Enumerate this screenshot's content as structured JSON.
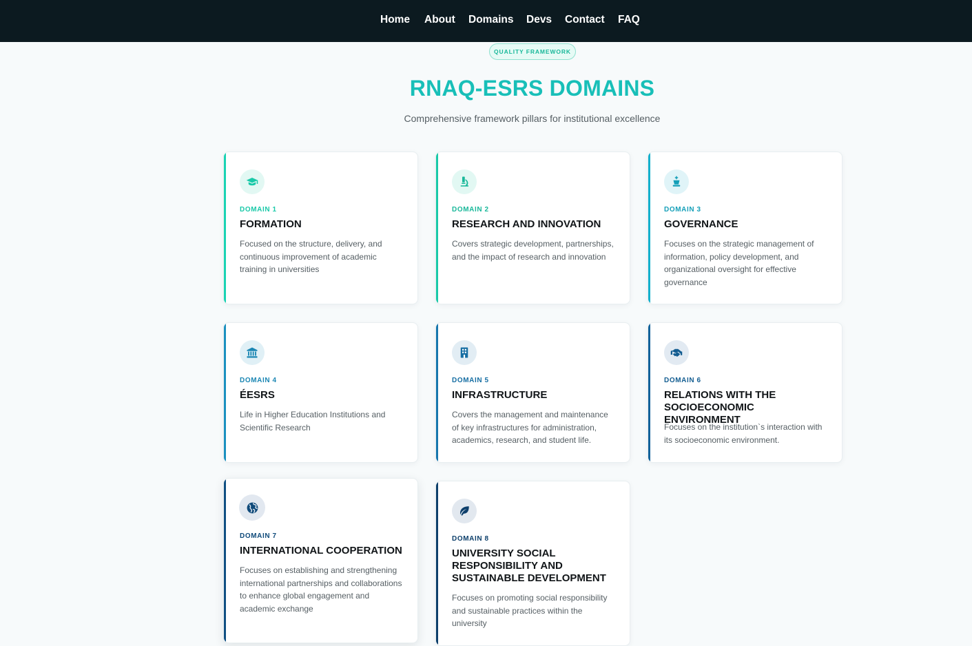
{
  "nav": {
    "items": [
      "Home",
      "About",
      "Domains",
      "Devs",
      "Contact",
      "FAQ"
    ]
  },
  "hero": {
    "badge": "QUALITY FRAMEWORK",
    "title": "RNAQ-ESRS DOMAINS",
    "subtitle": "Comprehensive framework pillars for institutional excellence"
  },
  "domains": [
    {
      "label": "DOMAIN 1",
      "title": "FORMATION",
      "description": "Focused on the structure, delivery, and continuous improvement of academic training in universities",
      "icon": "graduation-cap-icon",
      "accent": "#19d3b3"
    },
    {
      "label": "DOMAIN 2",
      "title": "RESEARCH AND INNOVATION",
      "description": "Covers strategic development, partnerships, and the impact of research and innovation",
      "icon": "microscope-icon",
      "accent": "#19c9a8"
    },
    {
      "label": "DOMAIN 3",
      "title": "GOVERNANCE",
      "description": "Focuses on the strategic management of information, policy development, and organizational oversight for effective governance",
      "icon": "chess-king-icon",
      "accent": "#14b0cc"
    },
    {
      "label": "DOMAIN 4",
      "title": "ÉESRS",
      "description": "Life in Higher Education Institutions and Scientific Research",
      "icon": "landmark-icon",
      "accent": "#1a90bf"
    },
    {
      "label": "DOMAIN 5",
      "title": "INFRASTRUCTURE",
      "description": "Covers the management and maintenance of key infrastructures for administration, academics, research, and student life.",
      "icon": "building-icon",
      "accent": "#1676ad"
    },
    {
      "label": "DOMAIN 6",
      "title": "RELATIONS WITH THE SOCIOECONOMIC ENVIRONMENT",
      "description": "Focuses on the institution`s interaction with its socioeconomic environment.",
      "icon": "handshake-icon",
      "accent": "#12629a"
    },
    {
      "label": "DOMAIN 7",
      "title": "INTERNATIONAL COOPERATION",
      "description": "Focuses on establishing and strengthening international partnerships and collaborations to enhance global engagement and academic exchange",
      "icon": "globe-icon",
      "accent": "#0f4f82"
    },
    {
      "label": "DOMAIN 8",
      "title": "UNIVERSITY SOCIAL RESPONSIBILITY AND SUSTAINABLE DEVELOPMENT",
      "description": "Focuses on promoting social responsibility and sustainable practices within the university",
      "icon": "leaf-icon",
      "accent": "#0d3f6b"
    }
  ]
}
